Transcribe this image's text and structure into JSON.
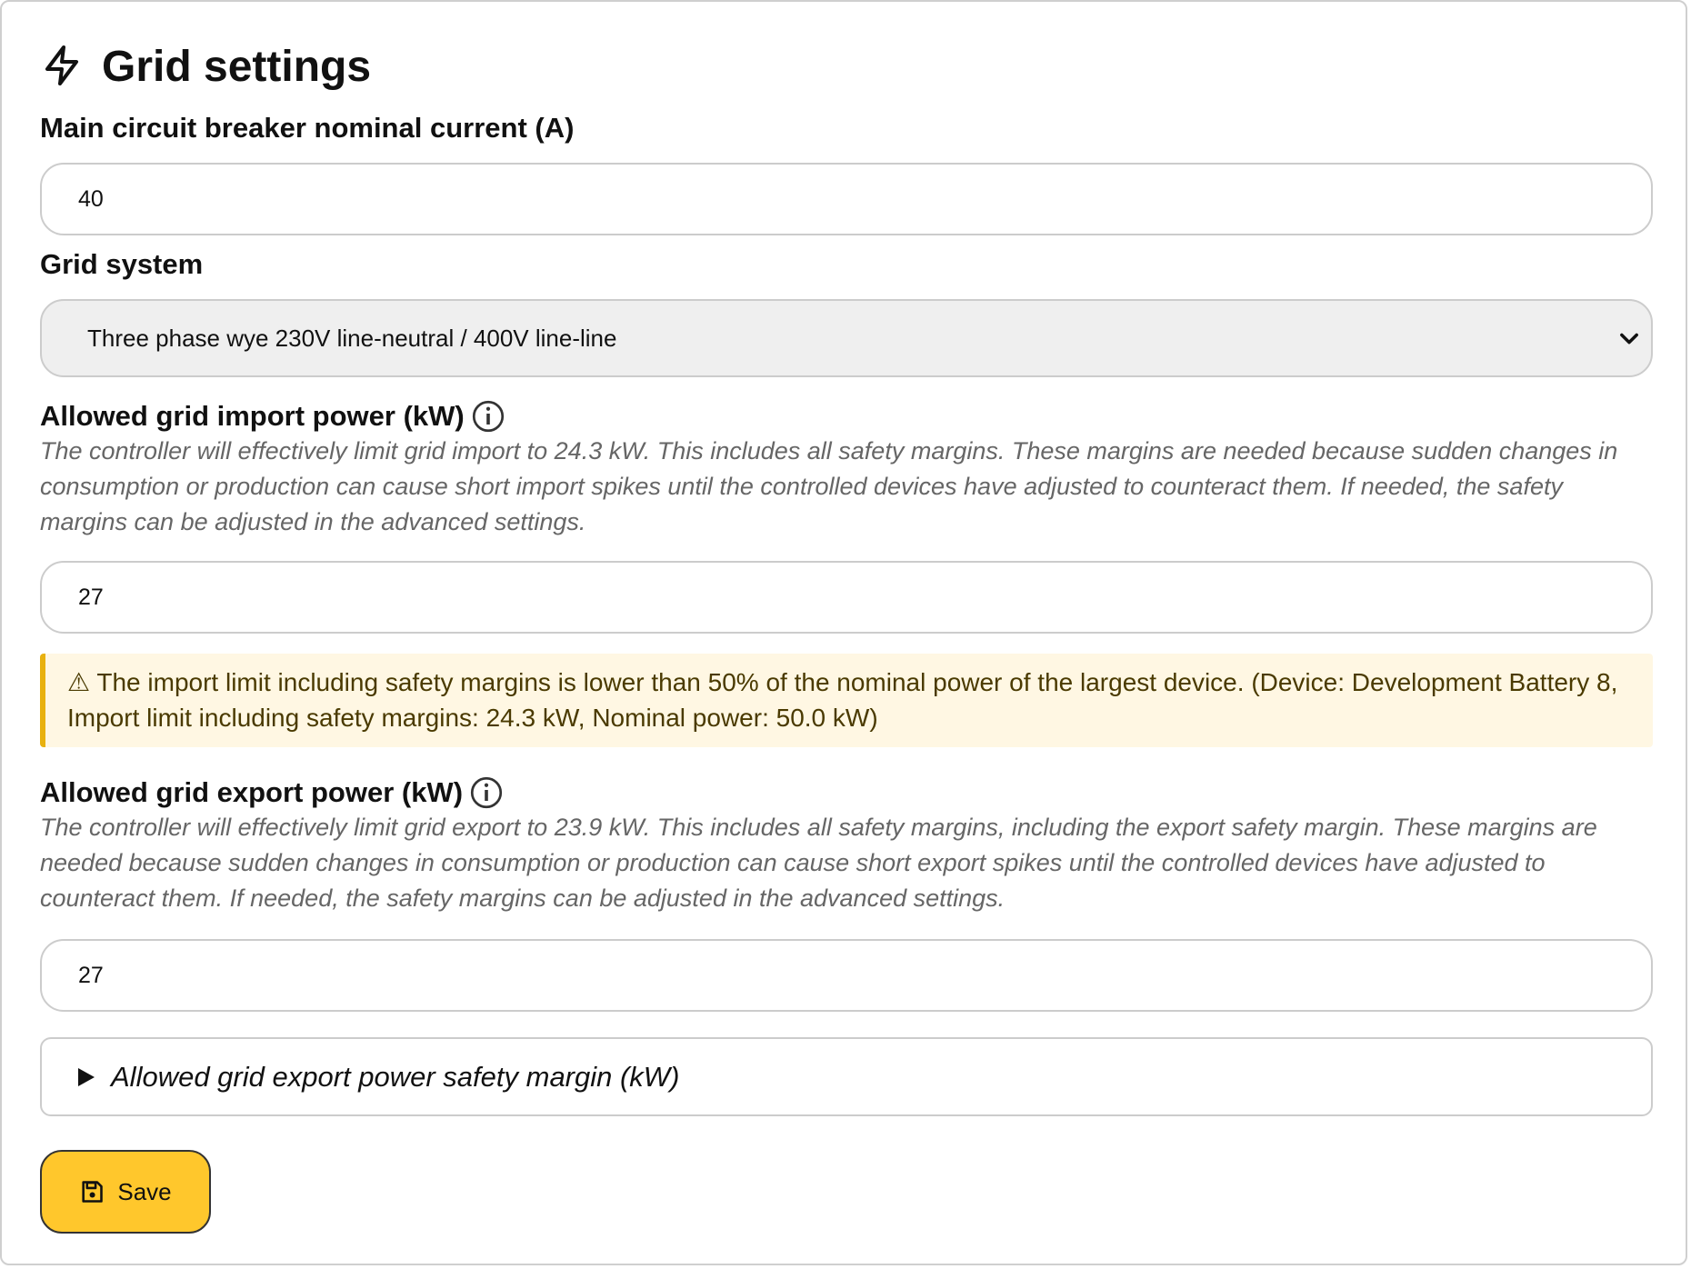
{
  "header": {
    "icon": "lightning-icon",
    "title": "Grid settings"
  },
  "breaker": {
    "label": "Main circuit breaker nominal current (A)",
    "value": "40"
  },
  "grid_system": {
    "label": "Grid system",
    "selected": "Three phase wye 230V line-neutral / 400V line-line"
  },
  "import_power": {
    "label": "Allowed grid import power (kW)",
    "help": "The controller will effectively limit grid import to 24.3 kW. This includes all safety margins. These margins are needed because sudden changes in consumption or production can cause short import spikes until the controlled devices have adjusted to counteract them. If needed, the safety margins can be adjusted in the advanced settings.",
    "value": "27"
  },
  "warning": {
    "text": "⚠ The import limit including safety margins is lower than 50% of the nominal power of the largest device. (Device: Development Battery 8, Import limit including safety margins: 24.3 kW, Nominal power: 50.0 kW)"
  },
  "export_power": {
    "label": "Allowed grid export power (kW)",
    "help": "The controller will effectively limit grid export to 23.9 kW. This includes all safety margins, including the export safety margin. These margins are needed because sudden changes in consumption or production can cause short export spikes until the controlled devices have adjusted to counteract them. If needed, the safety margins can be adjusted in the advanced settings.",
    "value": "27"
  },
  "export_margin": {
    "summary": "Allowed grid export power safety margin (kW)"
  },
  "save": {
    "label": "Save",
    "icon": "floppy-disk-icon"
  },
  "colors": {
    "accent": "#ffc72c",
    "warning_bg": "#fff7e3",
    "warning_border": "#e8b10f",
    "help_text": "#666666"
  }
}
